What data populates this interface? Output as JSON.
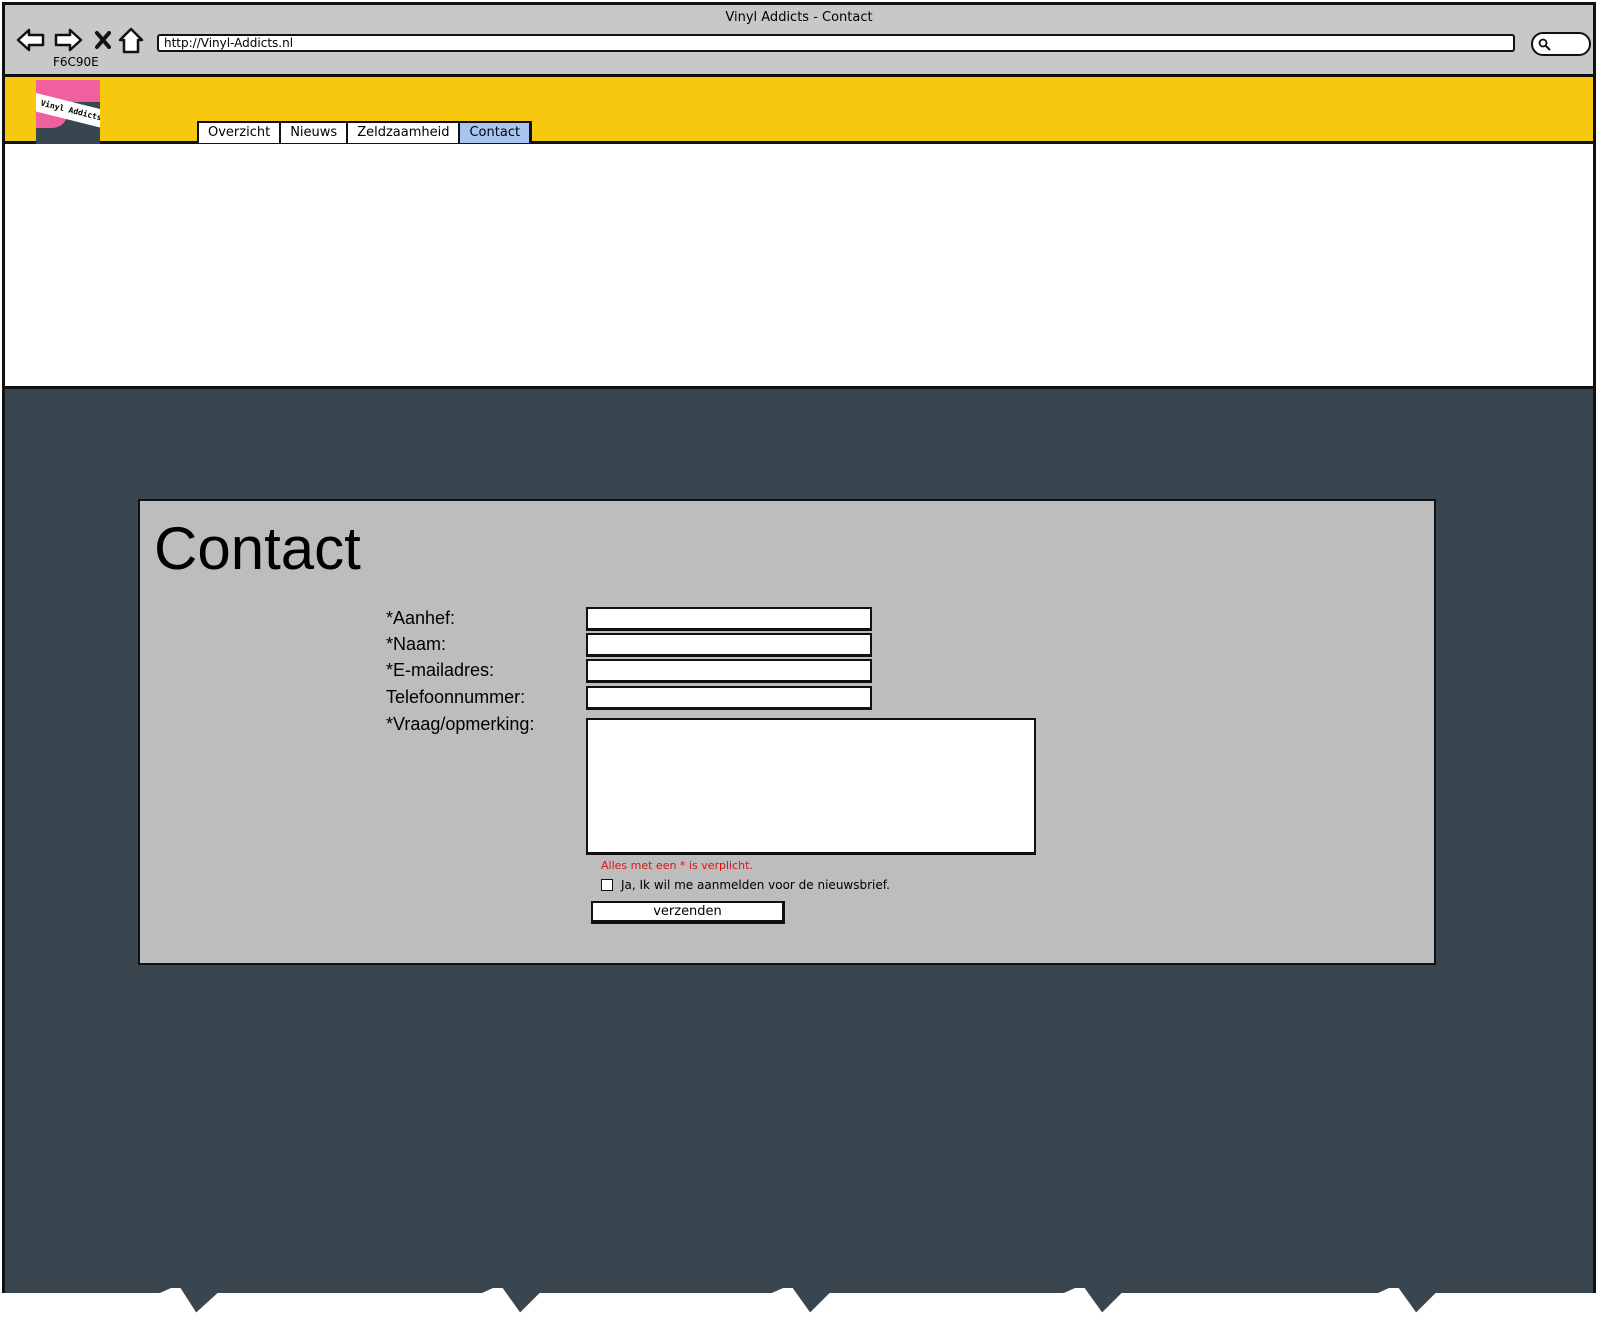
{
  "browser": {
    "window_title": "Vinyl Addicts - Contact",
    "url": "http://Vinyl-Addicts.nl",
    "color_label": "F6C90E",
    "icons": [
      "back-arrow-icon",
      "forward-arrow-icon",
      "close-icon",
      "home-icon",
      "search-icon"
    ]
  },
  "site": {
    "logo_text": "Vinyl Addicts",
    "brand_color": "#F6C90E",
    "tabs": [
      {
        "label": "Overzicht",
        "active": false
      },
      {
        "label": "Nieuws",
        "active": false
      },
      {
        "label": "Zeldzaamheid",
        "active": false
      },
      {
        "label": "Contact",
        "active": true
      }
    ]
  },
  "contact": {
    "title": "Contact",
    "fields": {
      "aanhef": {
        "label": "*Aanhef:",
        "value": ""
      },
      "naam": {
        "label": "*Naam:",
        "value": ""
      },
      "email": {
        "label": "*E-mailadres:",
        "value": ""
      },
      "telefoon": {
        "label": "Telefoonnummer:",
        "value": ""
      },
      "vraag": {
        "label": "*Vraag/opmerking:",
        "value": ""
      }
    },
    "required_note": "Alles met een * is verplicht.",
    "newsletter_label": "Ja, Ik wil me aanmelden voor de nieuwsbrief.",
    "newsletter_checked": false,
    "submit_label": "verzenden"
  },
  "colors": {
    "header_yellow": "#F6C90E",
    "page_dark": "#394650",
    "panel_grey": "#BDBDBD",
    "active_tab": "#A7C5F0",
    "required_red": "#E21010",
    "logo_pink": "#F0609E"
  }
}
